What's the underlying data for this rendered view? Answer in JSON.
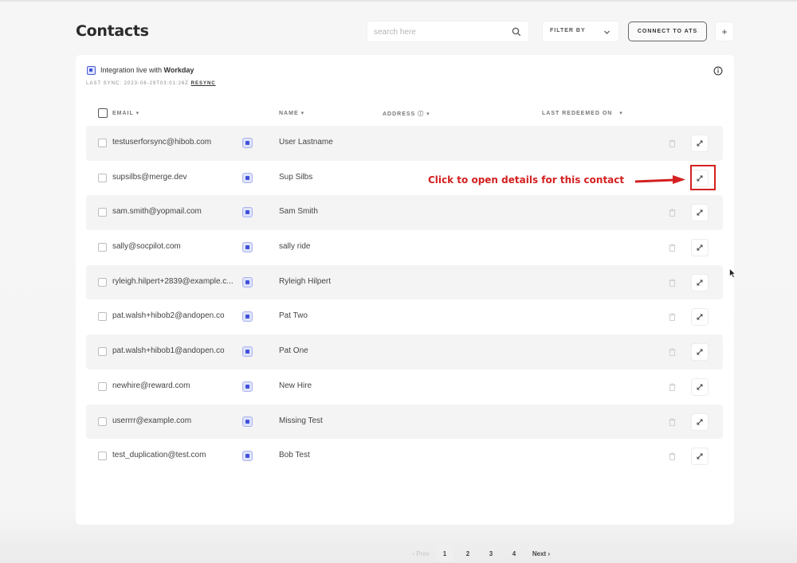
{
  "header": {
    "title": "Contacts",
    "search_placeholder": "search here",
    "filter_label": "FILTER BY",
    "connect_button": "CONNECT TO ATS",
    "add_button": "+"
  },
  "integration": {
    "status_prefix": "Integration live with ",
    "provider": "Workday",
    "last_sync": "LAST SYNC: 2023-06-29T03:01:26Z",
    "resync_label": "RESYNC"
  },
  "table": {
    "columns": {
      "email": "EMAIL",
      "name": "NAME",
      "address": "ADDRESS",
      "last_redeemed": "LAST REDEEMED ON"
    },
    "rows": [
      {
        "email": "testuserforsync@hibob.com",
        "name": "User Lastname"
      },
      {
        "email": "supsilbs@merge.dev",
        "name": "Sup Silbs"
      },
      {
        "email": "sam.smith@yopmail.com",
        "name": "Sam Smith"
      },
      {
        "email": "sally@socpilot.com",
        "name": "sally ride"
      },
      {
        "email": "ryleigh.hilpert+2839@example.c...",
        "name": "Ryleigh Hilpert"
      },
      {
        "email": "pat.walsh+hibob2@andopen.co",
        "name": "Pat Two"
      },
      {
        "email": "pat.walsh+hibob1@andopen.co",
        "name": "Pat One"
      },
      {
        "email": "newhire@reward.com",
        "name": "New Hire"
      },
      {
        "email": "userrrr@example.com",
        "name": "Missing Test"
      },
      {
        "email": "test_duplication@test.com",
        "name": "Bob Test"
      }
    ]
  },
  "annotation": {
    "text": "Click to open details for this contact",
    "color": "#d42020"
  },
  "pagination": {
    "prev": "‹ Prev",
    "pages": [
      "1",
      "2",
      "3",
      "4"
    ],
    "current": "1",
    "next": "Next ›"
  },
  "colors": {
    "accent": "#3f51d9",
    "annotation": "#d42020"
  }
}
